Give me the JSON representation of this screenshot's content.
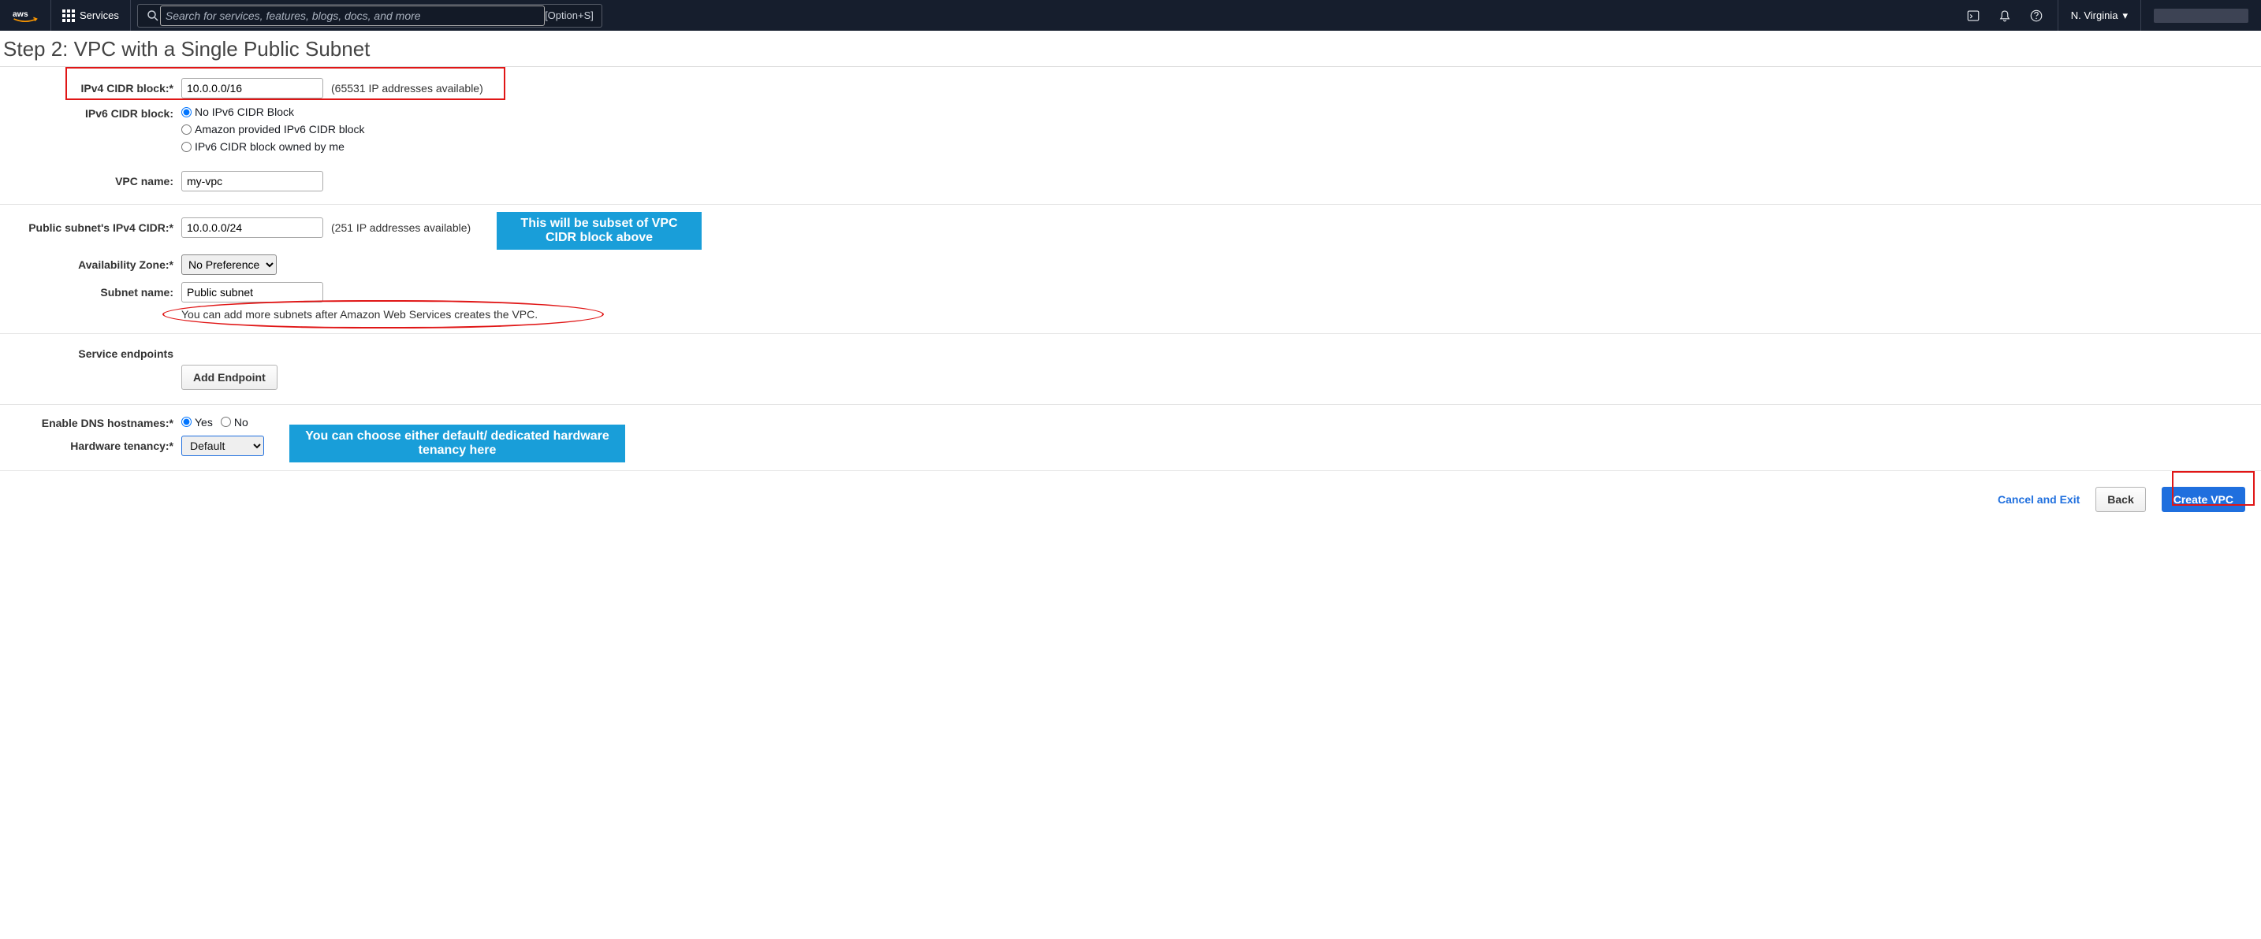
{
  "nav": {
    "services_label": "Services",
    "search_placeholder": "Search for services, features, blogs, docs, and more",
    "search_hint": "[Option+S]",
    "region": "N. Virginia"
  },
  "page": {
    "title": "Step 2: VPC with a Single Public Subnet"
  },
  "form": {
    "ipv4_label": "IPv4 CIDR block:*",
    "ipv4_value": "10.0.0.0/16",
    "ipv4_hint": "(65531 IP addresses available)",
    "ipv6_label": "IPv6 CIDR block:",
    "ipv6_opt1": "No IPv6 CIDR Block",
    "ipv6_opt2": "Amazon provided IPv6 CIDR block",
    "ipv6_opt3": "IPv6 CIDR block owned by me",
    "vpc_name_label": "VPC name:",
    "vpc_name_value": "my-vpc",
    "pub_subnet_label": "Public subnet's IPv4 CIDR:*",
    "pub_subnet_value": "10.0.0.0/24",
    "pub_subnet_hint": "(251 IP addresses available)",
    "az_label": "Availability Zone:*",
    "az_value": "No Preference",
    "subnet_name_label": "Subnet name:",
    "subnet_name_value": "Public subnet",
    "subnet_hint": "You can add more subnets after Amazon Web Services creates the VPC.",
    "endpoints_label": "Service endpoints",
    "add_endpoint_btn": "Add Endpoint",
    "dns_label": "Enable DNS hostnames:*",
    "dns_yes": "Yes",
    "dns_no": "No",
    "tenancy_label": "Hardware tenancy:*",
    "tenancy_value": "Default"
  },
  "footer": {
    "cancel": "Cancel and Exit",
    "back": "Back",
    "create": "Create VPC"
  },
  "annotations": {
    "note1": "This will be subset of VPC CIDR block above",
    "note2": "You can choose either default/ dedicated hardware tenancy here"
  }
}
